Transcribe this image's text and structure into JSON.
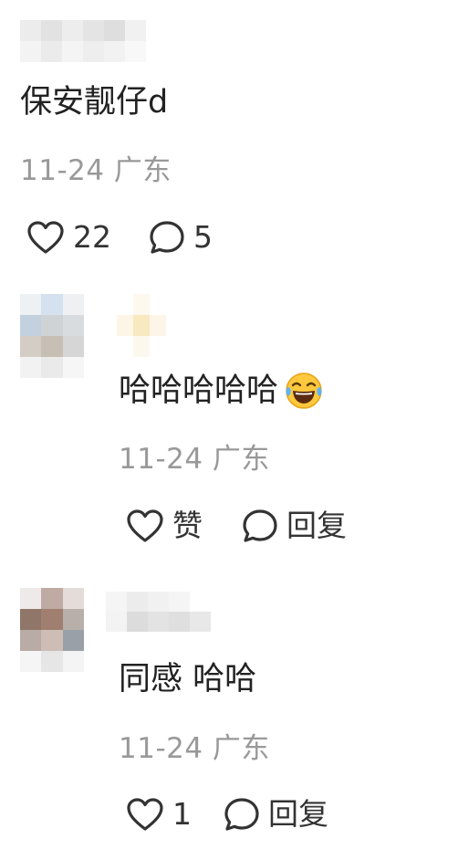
{
  "comments": [
    {
      "text": "保安靓仔d",
      "emoji": "",
      "meta": "11-24 广东",
      "like_label": "22",
      "reply_label": "5"
    },
    {
      "text": "哈哈哈哈哈",
      "emoji": "😂",
      "meta": "11-24 广东",
      "like_label": "赞",
      "reply_label": "回复"
    },
    {
      "text": "同感 哈哈",
      "emoji": "",
      "meta": "11-24 广东",
      "like_label": "1",
      "reply_label": "回复"
    }
  ],
  "icons": {
    "like": "heart-outline-icon",
    "reply": "speech-bubble-icon"
  },
  "colors": {
    "text": "#222222",
    "meta": "#999999",
    "icon": "#333333"
  }
}
